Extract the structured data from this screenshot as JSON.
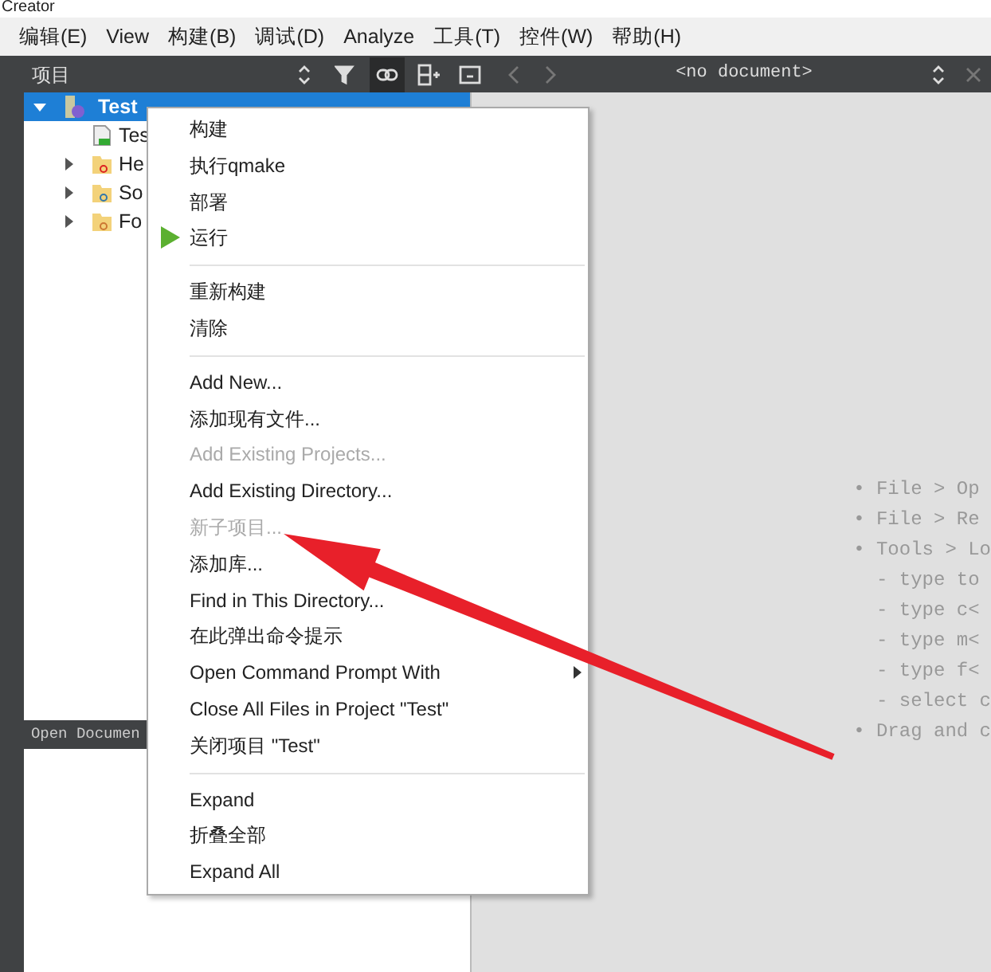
{
  "window": {
    "title": "Creator"
  },
  "menu_bar": [
    {
      "label": "编辑(E)"
    },
    {
      "label": "View"
    },
    {
      "label": "构建(B)"
    },
    {
      "label": "调试(D)"
    },
    {
      "label": "Analyze"
    },
    {
      "label": "工具(T)"
    },
    {
      "label": "控件(W)"
    },
    {
      "label": "帮助(H)"
    }
  ],
  "project_toolbar": {
    "title": "项目",
    "link_pressed": true
  },
  "editor_toolbar": {
    "document": "<no document>"
  },
  "tree": [
    {
      "label": "Test",
      "selected": true,
      "expanded": true,
      "children": [
        {
          "label": "Tes",
          "kind": "pro"
        },
        {
          "label": "He",
          "kind": "headers",
          "expanded": false
        },
        {
          "label": "So",
          "kind": "sources",
          "expanded": false
        },
        {
          "label": "Fo",
          "kind": "forms",
          "expanded": false
        }
      ]
    }
  ],
  "open_documents": {
    "title": "Open Documen"
  },
  "welcome_lines": [
    {
      "text": "• File > Op"
    },
    {
      "text": "• File > Re"
    },
    {
      "text": "• Tools > Lo"
    },
    {
      "text": "  - type to"
    },
    {
      "text": "  - type c<"
    },
    {
      "text": "  - type m<"
    },
    {
      "text": "  - type f<"
    },
    {
      "text": "  - select c"
    },
    {
      "text": "• Drag and c"
    }
  ],
  "context_menu": [
    {
      "kind": "item",
      "label": "构建",
      "disabled": false,
      "submenu": false
    },
    {
      "kind": "item",
      "label": "执行qmake",
      "disabled": false,
      "submenu": false
    },
    {
      "kind": "item",
      "label": "部署",
      "disabled": false,
      "submenu": false
    },
    {
      "kind": "run",
      "label": "运行",
      "disabled": false,
      "submenu": false
    },
    {
      "kind": "separator"
    },
    {
      "kind": "item",
      "label": "重新构建",
      "disabled": false,
      "submenu": false
    },
    {
      "kind": "item",
      "label": "清除",
      "disabled": false,
      "submenu": false
    },
    {
      "kind": "separator"
    },
    {
      "kind": "item",
      "label": "Add New...",
      "disabled": false,
      "submenu": false
    },
    {
      "kind": "item",
      "label": "添加现有文件...",
      "disabled": false,
      "submenu": false
    },
    {
      "kind": "item",
      "label": "Add Existing Projects...",
      "disabled": true,
      "submenu": false
    },
    {
      "kind": "item",
      "label": "Add Existing Directory...",
      "disabled": false,
      "submenu": false
    },
    {
      "kind": "item",
      "label": "新子项目...",
      "disabled": true,
      "submenu": false
    },
    {
      "kind": "item",
      "label": "添加库...",
      "disabled": false,
      "submenu": false
    },
    {
      "kind": "item",
      "label": "Find in This Directory...",
      "disabled": false,
      "submenu": false
    },
    {
      "kind": "item",
      "label": "在此弹出命令提示",
      "disabled": false,
      "submenu": false
    },
    {
      "kind": "item",
      "label": "Open Command Prompt With",
      "disabled": false,
      "submenu": true
    },
    {
      "kind": "item",
      "label": "Close All Files in Project \"Test\"",
      "disabled": false,
      "submenu": false
    },
    {
      "kind": "item",
      "label": "关闭项目 \"Test\"",
      "disabled": false,
      "submenu": false
    },
    {
      "kind": "separator"
    },
    {
      "kind": "item",
      "label": "Expand",
      "disabled": false,
      "submenu": false
    },
    {
      "kind": "item",
      "label": "折叠全部",
      "disabled": false,
      "submenu": false
    },
    {
      "kind": "item",
      "label": "Expand All",
      "disabled": false,
      "submenu": false
    }
  ]
}
